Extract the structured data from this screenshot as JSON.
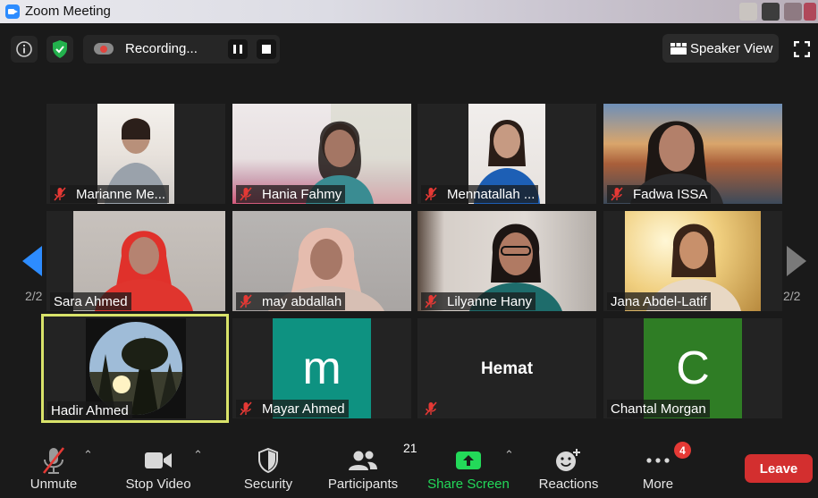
{
  "window": {
    "title": "Zoom Meeting"
  },
  "topbar": {
    "recording_label": "Recording...",
    "view_button": "Speaker View",
    "info_icon": "info-icon",
    "security_icon": "shield-check-icon"
  },
  "pagination": {
    "left": "2/2",
    "right": "2/2"
  },
  "participants": [
    {
      "name": "Marianne Me...",
      "muted": true
    },
    {
      "name": "Hania Fahmy",
      "muted": true
    },
    {
      "name": "Mennatallah ...",
      "muted": true
    },
    {
      "name": "Fadwa ISSA",
      "muted": true
    },
    {
      "name": "Sara Ahmed",
      "muted": false
    },
    {
      "name": "may abdallah",
      "muted": true
    },
    {
      "name": "Lilyanne Hany",
      "muted": true
    },
    {
      "name": "Jana Abdel-Latif",
      "muted": false
    },
    {
      "name": "Hadir Ahmed",
      "muted": false,
      "active_speaker": true
    },
    {
      "name": "Mayar Ahmed",
      "muted": true,
      "avatar_letter": "m",
      "avatar_color": "#0e9281"
    },
    {
      "name": "Hemat",
      "muted": true,
      "name_only": true
    },
    {
      "name": "Chantal Morgan",
      "muted": false,
      "avatar_letter": "C",
      "avatar_color": "#2f7d25"
    }
  ],
  "toolbar": {
    "unmute": "Unmute",
    "stop_video": "Stop Video",
    "security": "Security",
    "participants": "Participants",
    "participants_count": "21",
    "share_screen": "Share Screen",
    "reactions": "Reactions",
    "more": "More",
    "more_badge": "4",
    "leave": "Leave"
  },
  "colors": {
    "share_green": "#23d959",
    "leave_red": "#d32f2f",
    "active_border": "#d9e36a"
  }
}
